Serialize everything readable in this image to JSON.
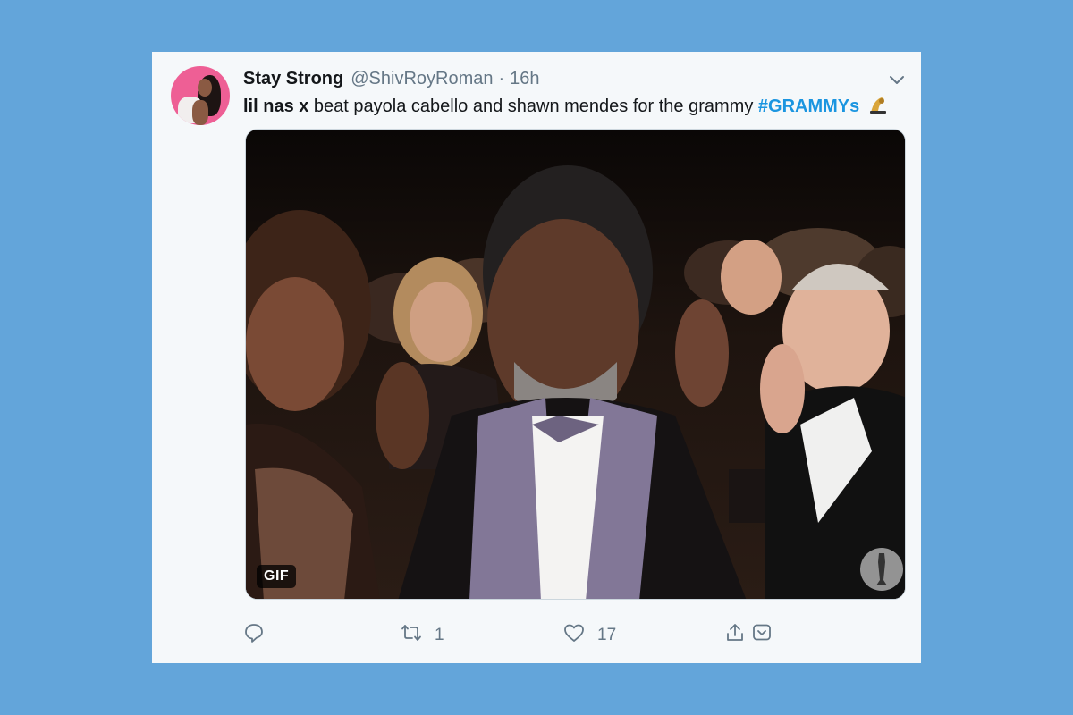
{
  "tweet": {
    "author_name": "Stay Strong",
    "author_handle": "@ShivRoyRoman",
    "separator": "·",
    "timestamp": "16h",
    "text_bold": "lil nas x",
    "text_body": " beat payola cabello and shawn mendes for the grammy ",
    "hashtag": "#GRAMMYs",
    "media_badge": "GIF",
    "retweet_count": "1",
    "like_count": "17"
  },
  "icons": [
    "chevron-down-icon",
    "trophy-icon",
    "reply-icon",
    "retweet-icon",
    "like-icon",
    "share-icon",
    "dm-icon",
    "oscar-logo-icon"
  ],
  "colors": {
    "background": "#63a5da",
    "card": "#f5f8fa",
    "hashtag": "#1b95e0",
    "muted": "#657786",
    "text": "#14171a"
  }
}
